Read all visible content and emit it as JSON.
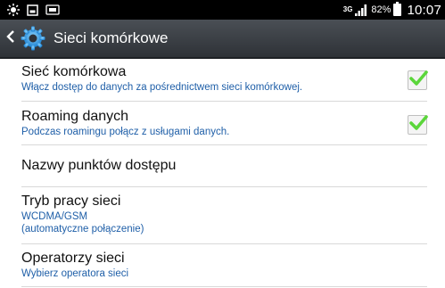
{
  "status_bar": {
    "network_type": "3G",
    "battery_percent": "82%",
    "time": "10:07",
    "icons": [
      "brightness-icon",
      "screenshot-icon",
      "sim-icon",
      "signal-icon",
      "battery-icon"
    ]
  },
  "header": {
    "title": "Sieci komórkowe",
    "back_icon": "back-chevron-icon",
    "app_icon": "settings-gear-icon"
  },
  "settings": [
    {
      "title": "Sieć komórkowa",
      "subtitle": "Włącz dostęp do danych za pośrednictwem sieci komórkowej.",
      "checked": true
    },
    {
      "title": "Roaming danych",
      "subtitle": "Podczas roamingu połącz z usługami danych.",
      "checked": true
    },
    {
      "title": "Nazwy punktów dostępu"
    },
    {
      "title": "Tryb pracy sieci",
      "subtitle_1": "WCDMA/GSM",
      "subtitle_2": "(automatyczne połączenie)"
    },
    {
      "title": "Operatorzy sieci",
      "subtitle": "Wybierz operatora sieci"
    }
  ],
  "colors": {
    "action_bar": "#3b3f44",
    "subtitle_text": "#1f5fa8",
    "check_mark": "#5bd63b"
  }
}
